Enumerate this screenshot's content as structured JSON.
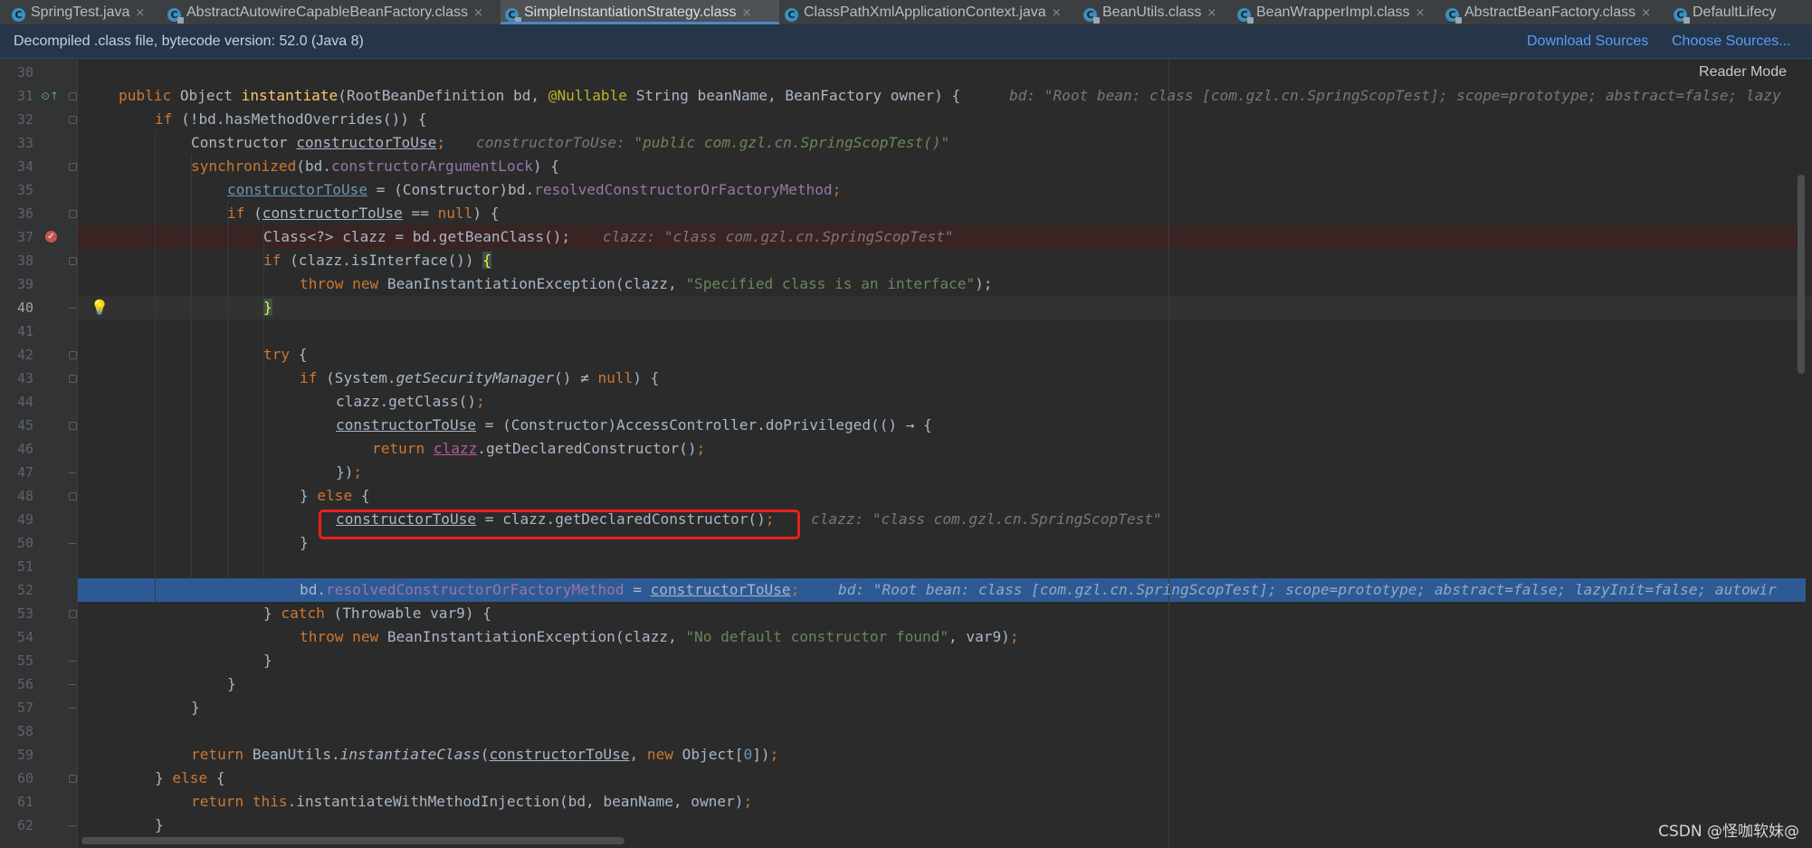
{
  "tabs": [
    {
      "label": "SpringTest.java",
      "icon": "java-class-icon"
    },
    {
      "label": "AbstractAutowireCapableBeanFactory.class",
      "icon": "compiled-class-icon"
    },
    {
      "label": "SimpleInstantiationStrategy.class",
      "icon": "compiled-class-icon",
      "active": true
    },
    {
      "label": "ClassPathXmlApplicationContext.java",
      "icon": "java-class-icon"
    },
    {
      "label": "BeanUtils.class",
      "icon": "compiled-class-icon"
    },
    {
      "label": "BeanWrapperImpl.class",
      "icon": "compiled-class-icon"
    },
    {
      "label": "AbstractBeanFactory.class",
      "icon": "compiled-class-icon"
    },
    {
      "label": "DefaultLifecy",
      "icon": "compiled-class-icon"
    }
  ],
  "banner": {
    "message": "Decompiled .class file, bytecode version: 52.0 (Java 8)",
    "download_sources": "Download Sources",
    "choose_sources": "Choose Sources..."
  },
  "editor": {
    "reader_mode": "Reader Mode",
    "line_numbers": [
      "30",
      "31",
      "32",
      "33",
      "34",
      "35",
      "36",
      "37",
      "38",
      "39",
      "40",
      "41",
      "42",
      "43",
      "44",
      "45",
      "46",
      "47",
      "48",
      "49",
      "50",
      "51",
      "52",
      "53",
      "54",
      "55",
      "56",
      "57",
      "58",
      "59",
      "60",
      "61",
      "62"
    ],
    "current_line": "40",
    "breakpoint_line": "37",
    "execution_line": "52"
  },
  "code": {
    "l31_public": "public",
    "l31_object": " Object ",
    "l31_name": "instantiate",
    "l31_params_a": "(RootBeanDefinition bd, ",
    "l31_annotation": "@Nullable",
    "l31_params_b": " String beanName, BeanFactory owner) {",
    "l31_hint": "bd: \"Root bean: class [com.gzl.cn.SpringScopTest]; scope=prototype; abstract=false; lazy",
    "l32_if": "if",
    "l32_rest": " (!bd.hasMethodOverrides()) {",
    "l33_type": "Constructor ",
    "l33_var": "constructorToUse",
    "l33_semi": ";",
    "l33_hint_label": "constructorToUse: ",
    "l33_hint_value": "\"public com.gzl.cn.SpringScopTest()\"",
    "l34_sync": "synchronized",
    "l34_a": "(bd.",
    "l34_field": "constructorArgumentLock",
    "l34_b": ") {",
    "l35_var": "constructorToUse",
    "l35_a": " = (Constructor)bd.",
    "l35_field": "resolvedConstructorOrFactoryMethod",
    "l35_semi": ";",
    "l36_if": "if",
    "l36_a": " (",
    "l36_var": "constructorToUse",
    "l36_b": " == ",
    "l36_null": "null",
    "l36_c": ") {",
    "l37_code": "Class<?> clazz = bd.getBeanClass();",
    "l37_hint": "clazz: \"class com.gzl.cn.SpringScopTest\"",
    "l38_if": "if",
    "l38_a": " (clazz.isInterface()) ",
    "l38_brace": "{",
    "l39_throw": "throw new",
    "l39_a": " BeanInstantiationException(clazz, ",
    "l39_str": "\"Specified class is an interface\"",
    "l39_b": ");",
    "l40_brace": "}",
    "l42_try": "try",
    "l42_a": " {",
    "l43_if": "if",
    "l43_a": " (System.",
    "l43_method": "getSecurityManager",
    "l43_b": "() ≠ ",
    "l43_null": "null",
    "l43_c": ") {",
    "l44_a": "clazz.getClass()",
    "l44_semi": ";",
    "l45_var": "constructorToUse",
    "l45_a": " = (Constructor)AccessController.doPrivileged(() → {",
    "l46_return": "return",
    "l46_space": " ",
    "l46_var": "clazz",
    "l46_a": ".getDeclaredConstructor()",
    "l46_semi": ";",
    "l47_a": "})",
    "l47_semi": ";",
    "l48_a": "} ",
    "l48_else": "else",
    "l48_b": " {",
    "l49_var": "constructorToUse",
    "l49_a": " = clazz.getDeclaredConstructor()",
    "l49_semi": ";",
    "l49_hint": "clazz: \"class com.gzl.cn.SpringScopTest\"",
    "l50_a": "}",
    "l52_a": "bd.",
    "l52_field": "resolvedConstructorOrFactoryMethod",
    "l52_b": " = ",
    "l52_var": "constructorToUse",
    "l52_semi": ";",
    "l52_hint": "bd: \"Root bean: class [com.gzl.cn.SpringScopTest]; scope=prototype; abstract=false; lazyInit=false; autowir",
    "l53_a": "} ",
    "l53_catch": "catch",
    "l53_b": " (Throwable var9) {",
    "l54_throw": "throw new",
    "l54_a": " BeanInstantiationException(clazz, ",
    "l54_str": "\"No default constructor found\"",
    "l54_b": ", var9)",
    "l54_semi": ";",
    "l55_a": "}",
    "l56_a": "}",
    "l57_a": "}",
    "l59_return": "return",
    "l59_a": " BeanUtils.",
    "l59_method": "instantiateClass",
    "l59_b": "(",
    "l59_var": "constructorToUse",
    "l59_c": ", ",
    "l59_new": "new",
    "l59_d": " Object[",
    "l59_num": "0",
    "l59_e": "])",
    "l59_semi": ";",
    "l60_a": "} ",
    "l60_else": "else",
    "l60_b": " {",
    "l61_return": "return",
    "l61_this": " this",
    "l61_a": ".instantiateWithMethodInjection(bd, beanName, owner)",
    "l61_semi": ";",
    "l62_a": "}"
  },
  "watermark": "CSDN @怪咖软妹@",
  "colors": {
    "editor_bg": "#2b2b2b",
    "keyword": "#cc7832",
    "string": "#6a8759",
    "execution_line": "#2d5a94",
    "breakpoint_line": "#3a2323",
    "highlight_box": "#e8211f",
    "link": "#589df6"
  }
}
